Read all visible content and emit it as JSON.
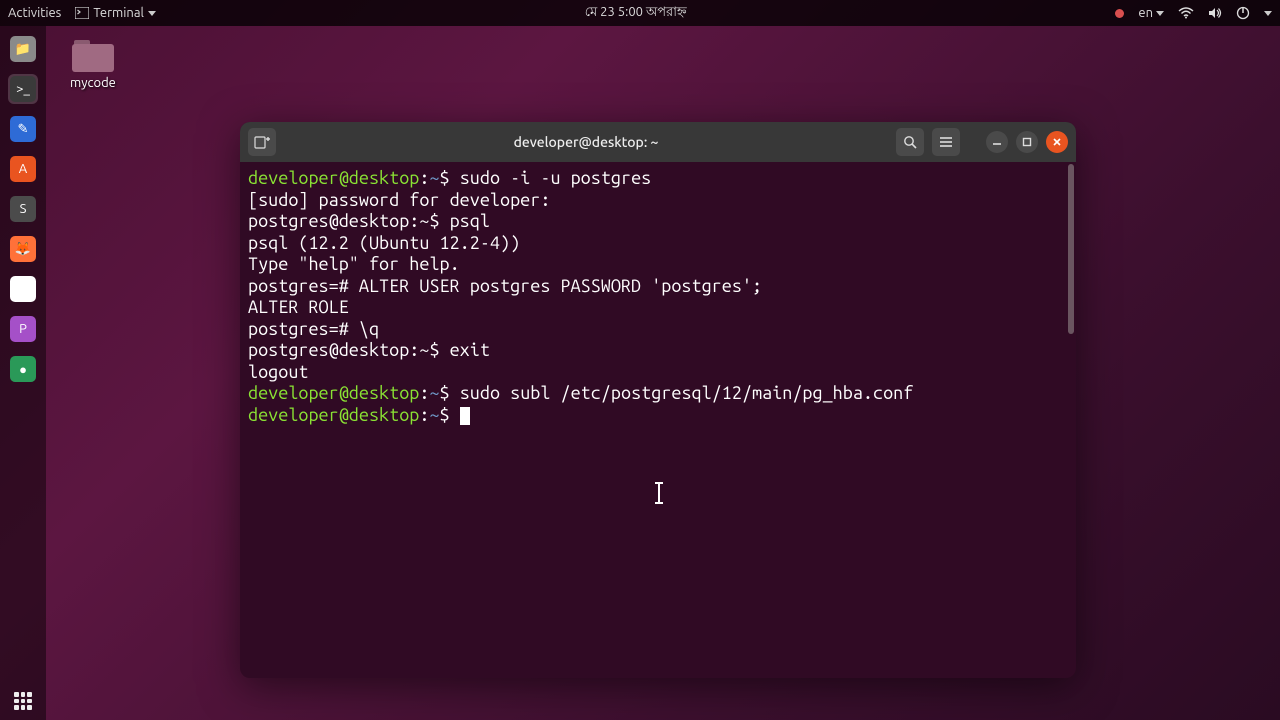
{
  "topbar": {
    "activities": "Activities",
    "app_name": "Terminal",
    "datetime": "মে 23  5:00 অপরাহ্ন",
    "lang": "en"
  },
  "desktop": {
    "folder_label": "mycode"
  },
  "terminal": {
    "title": "developer@desktop: ~",
    "prompt_user": "developer@desktop",
    "prompt_path": "~",
    "lines": [
      {
        "t": "p",
        "user": "developer@desktop",
        "cmd": "sudo -i -u postgres"
      },
      {
        "t": "o",
        "text": "[sudo] password for developer: "
      },
      {
        "t": "o",
        "text": "postgres@desktop:~$ psql"
      },
      {
        "t": "o",
        "text": "psql (12.2 (Ubuntu 12.2-4))"
      },
      {
        "t": "o",
        "text": "Type \"help\" for help."
      },
      {
        "t": "o",
        "text": ""
      },
      {
        "t": "o",
        "text": "postgres=# ALTER USER postgres PASSWORD 'postgres';"
      },
      {
        "t": "o",
        "text": "ALTER ROLE"
      },
      {
        "t": "o",
        "text": "postgres=# \\q"
      },
      {
        "t": "o",
        "text": "postgres@desktop:~$ exit"
      },
      {
        "t": "o",
        "text": "logout"
      },
      {
        "t": "p",
        "user": "developer@desktop",
        "cmd": "sudo subl /etc/postgresql/12/main/pg_hba.conf"
      },
      {
        "t": "p",
        "user": "developer@desktop",
        "cmd": "",
        "cursor": true
      }
    ]
  },
  "dock": {
    "items": [
      {
        "name": "files-icon",
        "bg": "#8a8a8a",
        "glyph": "📁"
      },
      {
        "name": "terminal-icon",
        "bg": "#3a3a3a",
        "glyph": ">_",
        "active": true
      },
      {
        "name": "gedit-icon",
        "bg": "#2e6bd6",
        "glyph": "✎"
      },
      {
        "name": "software-icon",
        "bg": "#e95420",
        "glyph": "A"
      },
      {
        "name": "sublime-icon",
        "bg": "#4b4b4b",
        "glyph": "S"
      },
      {
        "name": "firefox-icon",
        "bg": "#ff7139",
        "glyph": "🦊"
      },
      {
        "name": "chrome-icon",
        "bg": "#fff",
        "glyph": "◉"
      },
      {
        "name": "phpstorm-icon",
        "bg": "#a550c8",
        "glyph": "P"
      },
      {
        "name": "app-icon",
        "bg": "#2a9958",
        "glyph": "●"
      }
    ]
  }
}
